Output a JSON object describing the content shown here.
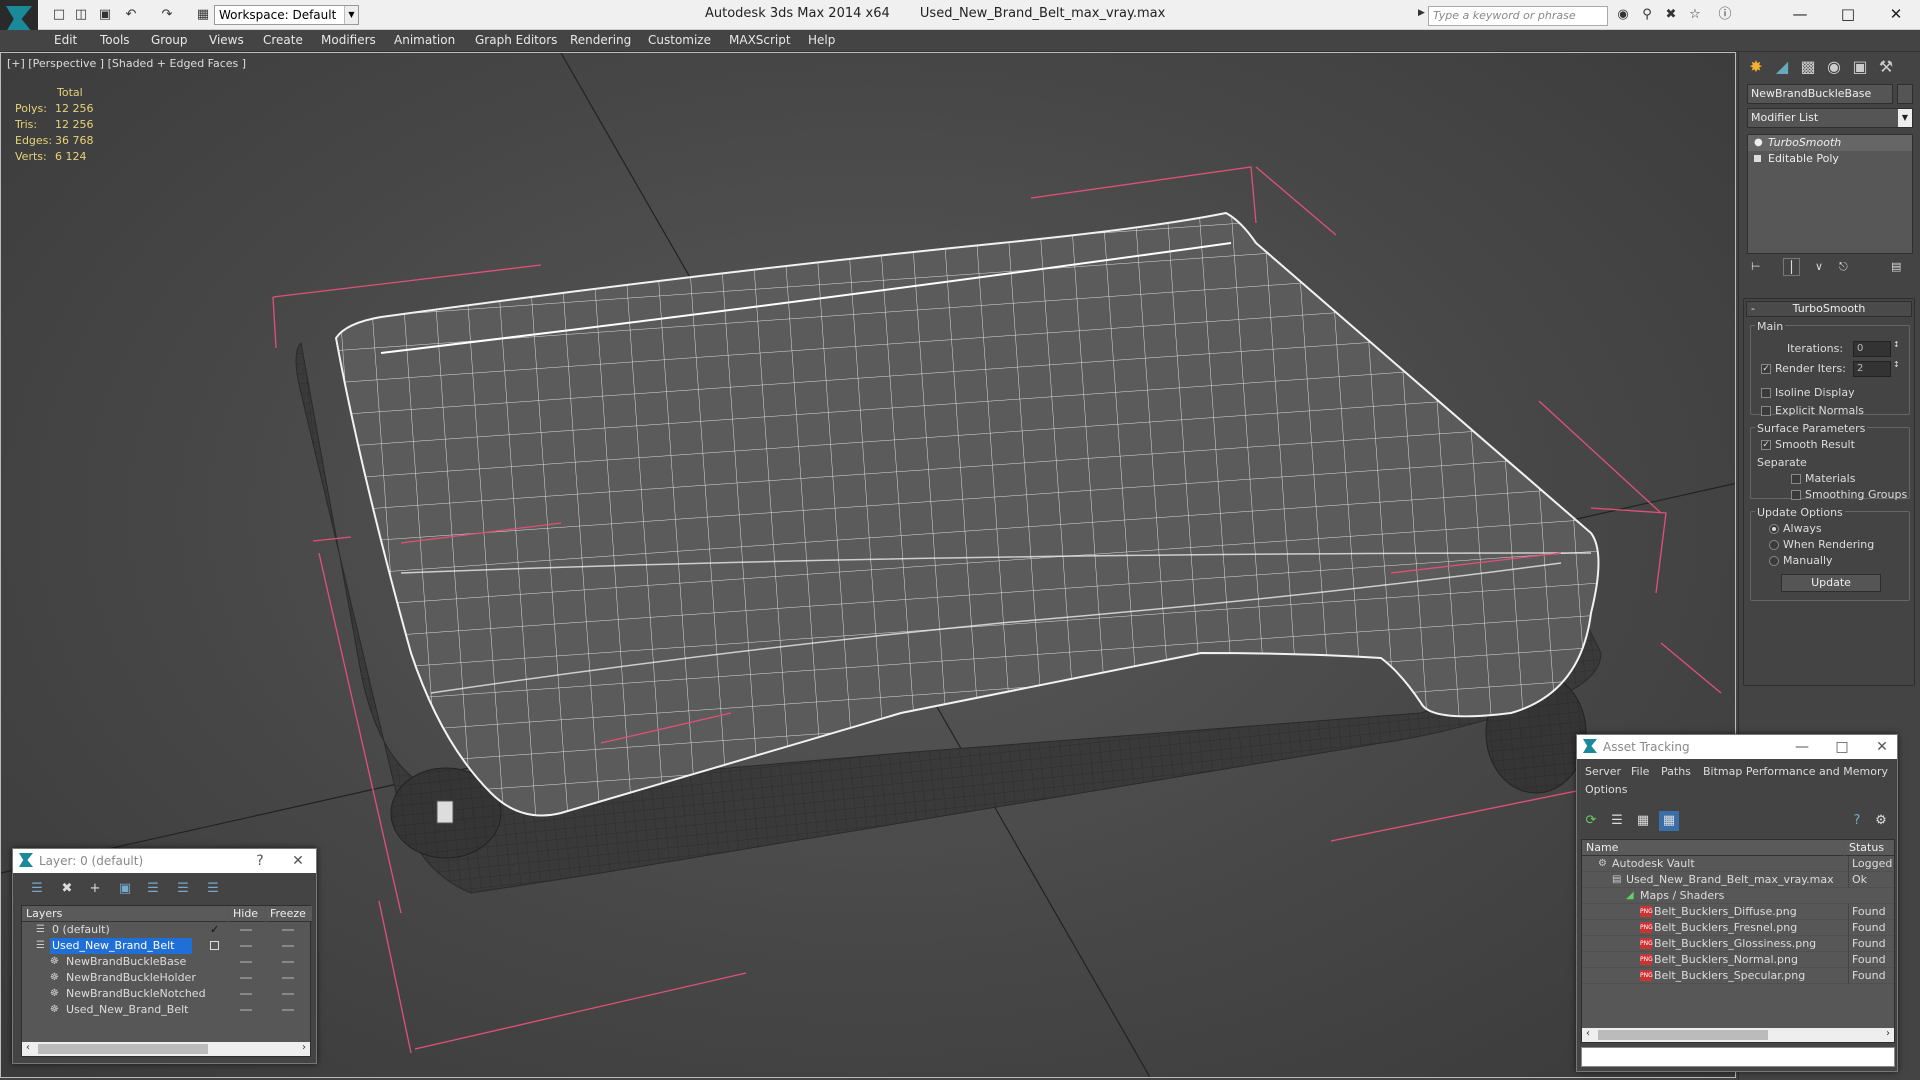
{
  "app": {
    "title": "Autodesk 3ds Max  2014 x64",
    "file": "Used_New_Brand_Belt_max_vray.max",
    "workspace": "Workspace: Default",
    "search_placeholder": "Type a keyword or phrase"
  },
  "menu": [
    "Edit",
    "Tools",
    "Group",
    "Views",
    "Create",
    "Modifiers",
    "Animation",
    "Graph Editors",
    "Rendering",
    "Customize",
    "MAXScript",
    "Help"
  ],
  "viewport": {
    "label": "[+] [Perspective ] [Shaded + Edged Faces ]",
    "stats": {
      "header": "Total",
      "rows": [
        {
          "label": "Polys:",
          "value": "12 256"
        },
        {
          "label": "Tris:",
          "value": "12 256"
        },
        {
          "label": "Edges:",
          "value": "36 768"
        },
        {
          "label": "Verts:",
          "value": "6 124"
        }
      ]
    }
  },
  "command_panel": {
    "object_name": "NewBrandBuckleBase",
    "modifier_list": "Modifier List",
    "stack": [
      "TurboSmooth",
      "Editable Poly"
    ],
    "rollout_title": "TurboSmooth",
    "main_group": "Main",
    "iterations_label": "Iterations:",
    "iterations_value": "0",
    "render_iters_label": "Render Iters:",
    "render_iters_value": "2",
    "isoline": "Isoline Display",
    "explicit_normals": "Explicit Normals",
    "surface_group": "Surface Parameters",
    "smooth_result": "Smooth Result",
    "separate": "Separate",
    "materials": "Materials",
    "smoothing_groups": "Smoothing Groups",
    "update_group": "Update Options",
    "always": "Always",
    "when_rendering": "When Rendering",
    "manually": "Manually",
    "update_button": "Update"
  },
  "layer_dialog": {
    "title": "Layer: 0 (default)",
    "help": "?",
    "columns": [
      "Layers",
      "Hide",
      "Freeze"
    ],
    "rows": [
      {
        "name": "0 (default)",
        "indent": 1
      },
      {
        "name": "Used_New_Brand_Belt",
        "indent": 1,
        "selected": true
      },
      {
        "name": "NewBrandBuckleBase",
        "indent": 2
      },
      {
        "name": "NewBrandBuckleHolder",
        "indent": 2
      },
      {
        "name": "NewBrandBuckleNotched",
        "indent": 2
      },
      {
        "name": "Used_New_Brand_Belt",
        "indent": 2
      }
    ]
  },
  "asset_dialog": {
    "title": "Asset Tracking",
    "menu": [
      "Server",
      "File",
      "Paths",
      "Bitmap Performance and Memory",
      "Options"
    ],
    "columns": [
      "Name",
      "Status"
    ],
    "rows": [
      {
        "name": "Autodesk Vault",
        "status": "Logged O",
        "indent": 1,
        "icon": "vault"
      },
      {
        "name": "Used_New_Brand_Belt_max_vray.max",
        "status": "Ok",
        "indent": 2,
        "icon": "max"
      },
      {
        "name": "Maps / Shaders",
        "status": "",
        "indent": 3,
        "icon": "maps"
      },
      {
        "name": "Belt_Bucklers_Diffuse.png",
        "status": "Found",
        "indent": 4,
        "icon": "png"
      },
      {
        "name": "Belt_Bucklers_Fresnel.png",
        "status": "Found",
        "indent": 4,
        "icon": "png"
      },
      {
        "name": "Belt_Bucklers_Glossiness.png",
        "status": "Found",
        "indent": 4,
        "icon": "png"
      },
      {
        "name": "Belt_Bucklers_Normal.png",
        "status": "Found",
        "indent": 4,
        "icon": "png"
      },
      {
        "name": "Belt_Bucklers_Specular.png",
        "status": "Found",
        "indent": 4,
        "icon": "png"
      }
    ]
  },
  "icons": {
    "png_badge": "PNG"
  },
  "colors": {
    "selection_blue": "#1f6fd6",
    "stats_yellow": "#e6d27a",
    "bbox_pink": "#e0507a"
  }
}
